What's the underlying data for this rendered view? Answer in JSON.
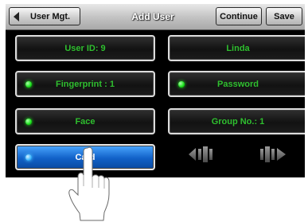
{
  "header": {
    "back_label": "User Mgt.",
    "title": "Add User",
    "continue_label": "Continue",
    "save_label": "Save"
  },
  "fields": {
    "user_id": "User ID: 9",
    "name": "Linda",
    "fingerprint": "Fingerprint : 1",
    "password": "Password",
    "face": "Face",
    "group": "Group No.: 1",
    "card": "Card"
  },
  "colors": {
    "field_text": "#2fbf2f",
    "indicator_green": "#18e018",
    "card_blue": "#1161c8"
  },
  "icons": {
    "prev": "previous-page-arrow-icon",
    "next": "next-page-arrow-icon",
    "pointer": "pointing-hand-icon"
  }
}
